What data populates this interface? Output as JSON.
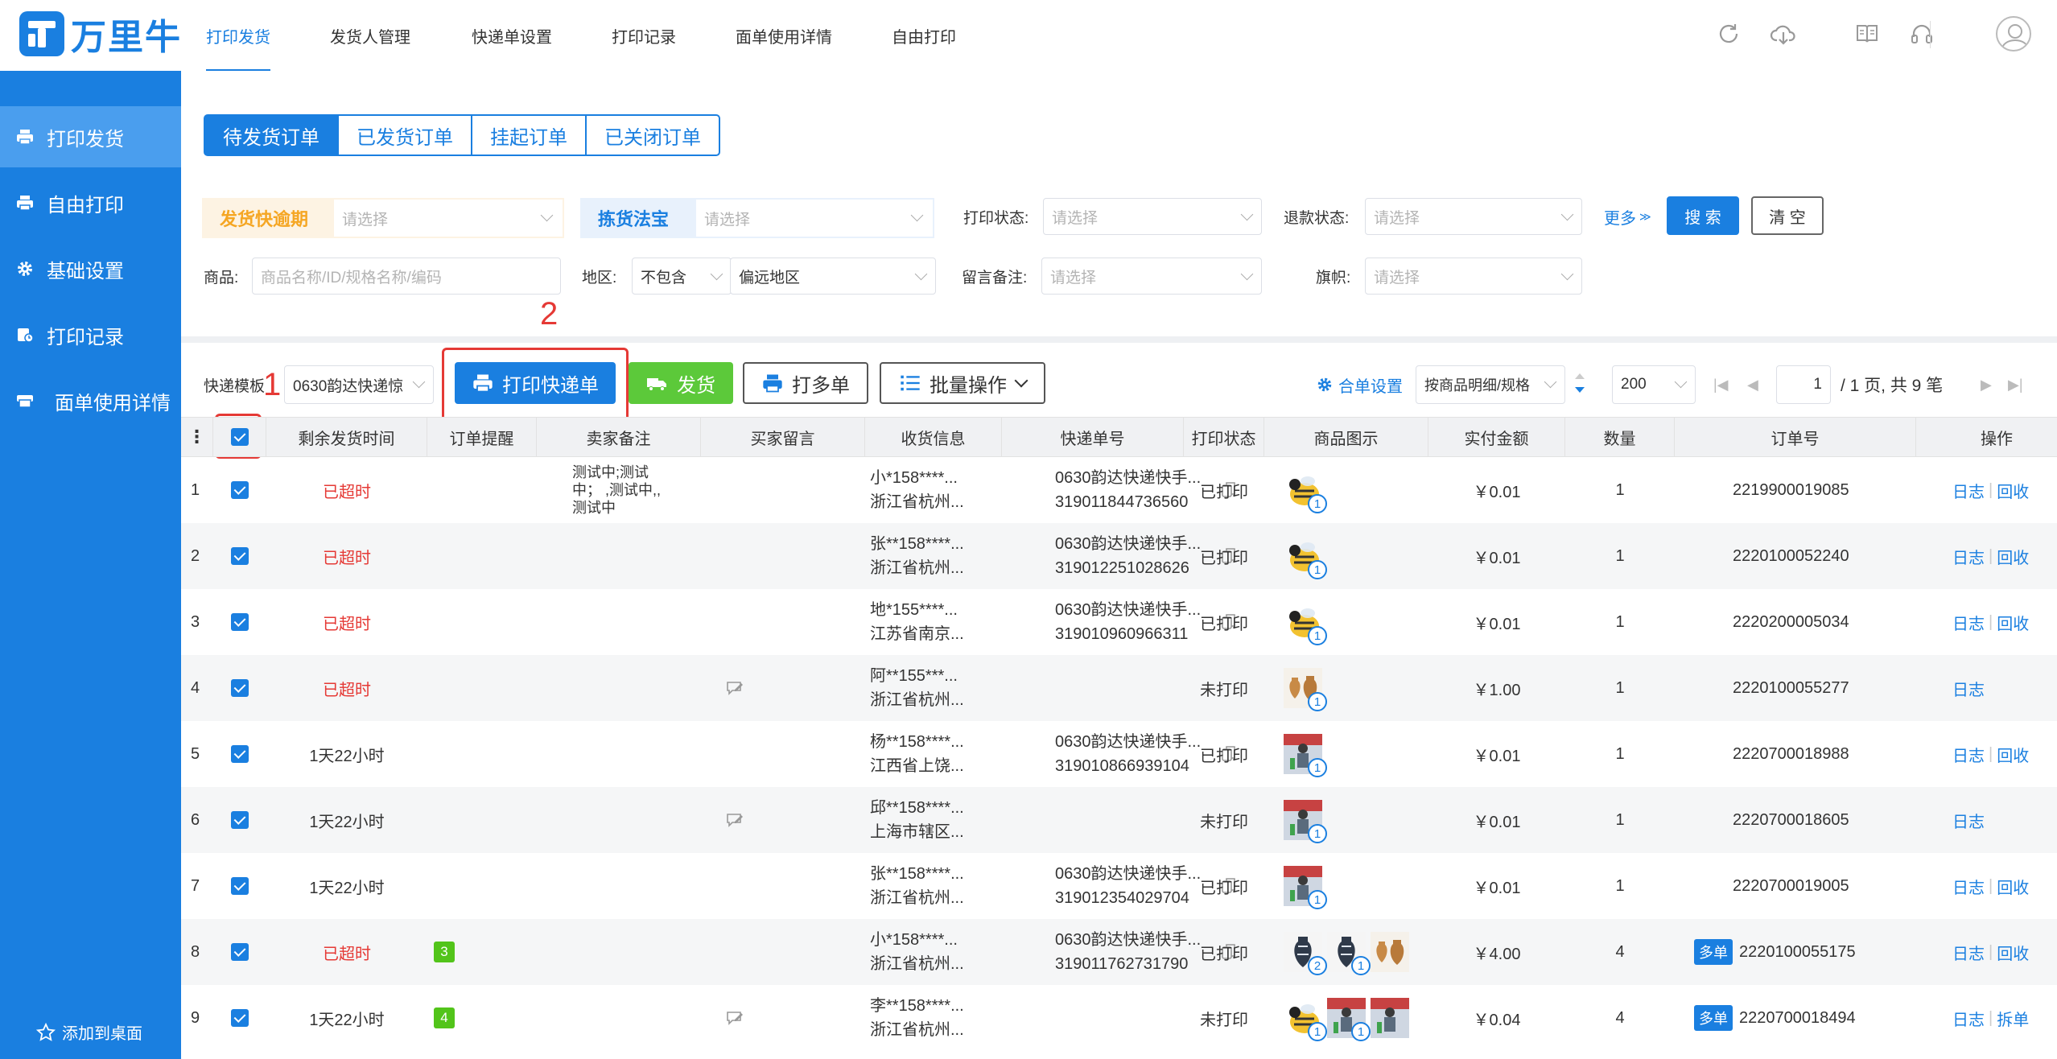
{
  "brand": {
    "name": "万里牛"
  },
  "topnav": [
    {
      "label": "打印发货",
      "active": true
    },
    {
      "label": "发货人管理"
    },
    {
      "label": "快递单设置"
    },
    {
      "label": "打印记录"
    },
    {
      "label": "面单使用详情"
    },
    {
      "label": "自由打印"
    }
  ],
  "topicons": [
    "refresh-icon",
    "cloud-download-icon",
    "book-icon",
    "headset-icon",
    "user-avatar-icon"
  ],
  "sidebar": {
    "items": [
      {
        "label": "打印发货",
        "icon": "printer-icon",
        "active": true
      },
      {
        "label": "自由打印",
        "icon": "printer-icon"
      },
      {
        "label": "基础设置",
        "icon": "gear-icon"
      },
      {
        "label": "打印记录",
        "icon": "record-icon"
      },
      {
        "label": "面单使用详情",
        "icon": "waybill-icon"
      }
    ],
    "add_desktop": "添加到桌面"
  },
  "order_tabs": [
    {
      "label": "待发货订单",
      "active": true
    },
    {
      "label": "已发货订单"
    },
    {
      "label": "挂起订单"
    },
    {
      "label": "已关闭订单"
    }
  ],
  "filters": {
    "overdue": {
      "label": "发货快逾期",
      "placeholder": "请选择",
      "color": "#f5a623",
      "bg": "#fdf3e3"
    },
    "picking": {
      "label": "拣货法宝",
      "placeholder": "请选择",
      "color": "#1a7fe0",
      "bg": "#e8f1fc"
    },
    "print_status": {
      "label": "打印状态:",
      "placeholder": "请选择"
    },
    "refund_status": {
      "label": "退款状态:",
      "placeholder": "请选择"
    },
    "more": "更多",
    "search": "搜 索",
    "clear": "清 空",
    "product": {
      "label": "商品:",
      "placeholder": "商品名称/ID/规格名称/编码"
    },
    "region": {
      "label": "地区:",
      "mode": "不包含",
      "value": "偏远地区"
    },
    "remark": {
      "label": "留言备注:",
      "placeholder": "请选择"
    },
    "flag": {
      "label": "旗帜:",
      "placeholder": "请选择"
    }
  },
  "toolbar": {
    "template_label": "快递模板",
    "template_value": "0630韵达快递惊",
    "print_waybill": "打印快递单",
    "ship": "发货",
    "print_multi": "打多单",
    "batch": "批量操作",
    "merge_setting": "合单设置",
    "sort_value": "按商品明细/规格",
    "page_size": "200",
    "page_current": "1",
    "page_info": "/  1 页, 共 9 笔",
    "annotations": [
      "1",
      "2"
    ]
  },
  "columns": [
    "剩余发货时间",
    "订单提醒",
    "卖家备注",
    "买家留言",
    "收货信息",
    "快递单号",
    "打印状态",
    "商品图示",
    "实付金额",
    "数量",
    "订单号",
    "操作"
  ],
  "rows": [
    {
      "idx": "1",
      "remain": "已超时",
      "overdue": true,
      "remind": "",
      "memo": [
        "测试中;测试",
        "中； ,测试中,,",
        "测试中"
      ],
      "memo_icon": false,
      "recv": [
        "小*158****...",
        "浙江省杭州..."
      ],
      "waybill": [
        "0630韵达快递快手...",
        "319011844736560"
      ],
      "status": "已打印",
      "thumbs": [
        {
          "k": "bee",
          "n": "1"
        }
      ],
      "amount": "￥0.01",
      "qty": "1",
      "multi": "",
      "order": "2219900019085",
      "ops": [
        "日志",
        "回收"
      ]
    },
    {
      "idx": "2",
      "remain": "已超时",
      "overdue": true,
      "remind": "",
      "memo": [],
      "memo_icon": false,
      "recv": [
        "张**158****...",
        "浙江省杭州..."
      ],
      "waybill": [
        "0630韵达快递快手...",
        "319012251028626"
      ],
      "status": "已打印",
      "thumbs": [
        {
          "k": "bee",
          "n": "1"
        }
      ],
      "amount": "￥0.01",
      "qty": "1",
      "multi": "",
      "order": "2220100052240",
      "ops": [
        "日志",
        "回收"
      ]
    },
    {
      "idx": "3",
      "remain": "已超时",
      "overdue": true,
      "remind": "",
      "memo": [],
      "memo_icon": false,
      "recv": [
        "地*155****...",
        "江苏省南京..."
      ],
      "waybill": [
        "0630韵达快递快手...",
        "319010960966311"
      ],
      "status": "已打印",
      "thumbs": [
        {
          "k": "bee",
          "n": "1"
        }
      ],
      "amount": "￥0.01",
      "qty": "1",
      "multi": "",
      "order": "2220200005034",
      "ops": [
        "日志",
        "回收"
      ]
    },
    {
      "idx": "4",
      "remain": "已超时",
      "overdue": true,
      "remind": "",
      "memo": [],
      "memo_icon": true,
      "recv": [
        "阿**155***...",
        "浙江省杭州..."
      ],
      "waybill": [],
      "status": "未打印",
      "thumbs": [
        {
          "k": "vase",
          "n": "1"
        }
      ],
      "amount": "￥1.00",
      "qty": "1",
      "multi": "",
      "order": "2220100055277",
      "ops": [
        "日志"
      ]
    },
    {
      "idx": "5",
      "remain": "1天22小时",
      "overdue": false,
      "remind": "",
      "memo": [],
      "memo_icon": false,
      "recv": [
        "杨**158****...",
        "江西省上饶..."
      ],
      "waybill": [
        "0630韵达快递快手...",
        "319010866939104"
      ],
      "status": "已打印",
      "thumbs": [
        {
          "k": "person",
          "n": "1"
        }
      ],
      "amount": "￥0.01",
      "qty": "1",
      "multi": "",
      "order": "2220700018988",
      "ops": [
        "日志",
        "回收"
      ]
    },
    {
      "idx": "6",
      "remain": "1天22小时",
      "overdue": false,
      "remind": "",
      "memo": [],
      "memo_icon": true,
      "recv": [
        "邱**158****...",
        "上海市辖区..."
      ],
      "waybill": [],
      "status": "未打印",
      "thumbs": [
        {
          "k": "person",
          "n": "1"
        }
      ],
      "amount": "￥0.01",
      "qty": "1",
      "multi": "",
      "order": "2220700018605",
      "ops": [
        "日志"
      ]
    },
    {
      "idx": "7",
      "remain": "1天22小时",
      "overdue": false,
      "remind": "",
      "memo": [],
      "memo_icon": false,
      "recv": [
        "张**158****...",
        "浙江省杭州..."
      ],
      "waybill": [
        "0630韵达快递快手...",
        "319012354029704"
      ],
      "status": "已打印",
      "thumbs": [
        {
          "k": "person",
          "n": "1"
        }
      ],
      "amount": "￥0.01",
      "qty": "1",
      "multi": "",
      "order": "2220700019005",
      "ops": [
        "日志",
        "回收"
      ]
    },
    {
      "idx": "8",
      "remain": "已超时",
      "overdue": true,
      "remind": "3",
      "memo": [],
      "memo_icon": false,
      "recv": [
        "小*158****...",
        "浙江省杭州..."
      ],
      "waybill": [
        "0630韵达快递快手...",
        "319011762731790"
      ],
      "status": "已打印",
      "thumbs": [
        {
          "k": "vase2",
          "n": "2"
        },
        {
          "k": "vase2",
          "n": "1"
        },
        {
          "k": "vase",
          "n": ""
        }
      ],
      "amount": "￥4.00",
      "qty": "4",
      "multi": "多单",
      "order": "2220100055175",
      "ops": [
        "日志",
        "回收"
      ]
    },
    {
      "idx": "9",
      "remain": "1天22小时",
      "overdue": false,
      "remind": "4",
      "memo": [],
      "memo_icon": true,
      "recv": [
        "李**158****...",
        "浙江省杭州..."
      ],
      "waybill": [],
      "status": "未打印",
      "thumbs": [
        {
          "k": "bee",
          "n": "1"
        },
        {
          "k": "person",
          "n": "1"
        },
        {
          "k": "person",
          "n": ""
        }
      ],
      "amount": "￥0.04",
      "qty": "4",
      "multi": "多单",
      "order": "2220700018494",
      "ops": [
        "日志",
        "拆单"
      ]
    }
  ]
}
